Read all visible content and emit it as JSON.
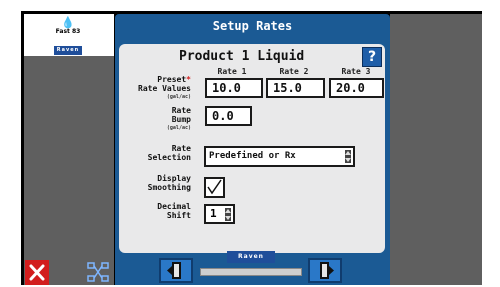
{
  "sidebar": {
    "logo_text": "Fast 83",
    "brand": "Raven"
  },
  "window": {
    "title": "Setup Rates",
    "product": "Product 1 Liquid",
    "help_label": "?"
  },
  "rates": {
    "headers": [
      "Rate 1",
      "Rate 2",
      "Rate 3"
    ],
    "values": [
      "10.0",
      "15.0",
      "20.0"
    ],
    "label_line1": "Preset",
    "label_line2": "Rate Values",
    "unit": "(gal/ac)"
  },
  "bump": {
    "label_line1": "Rate",
    "label_line2": "Bump",
    "unit": "(gal/ac)",
    "value": "0.0"
  },
  "selection": {
    "label_line1": "Rate",
    "label_line2": "Selection",
    "value": "Predefined or Rx"
  },
  "smoothing": {
    "label_line1": "Display",
    "label_line2": "Smoothing",
    "checked": true
  },
  "decimal": {
    "label_line1": "Decimal",
    "label_line2": "Shift",
    "value": "1"
  },
  "footer": {
    "brand": "Raven",
    "progress": 0.0
  },
  "colors": {
    "window_blue": "#1b5a94",
    "panel": "#e9e9ea",
    "close_red": "#d21d1d",
    "button_blue": "#2a78c8"
  }
}
